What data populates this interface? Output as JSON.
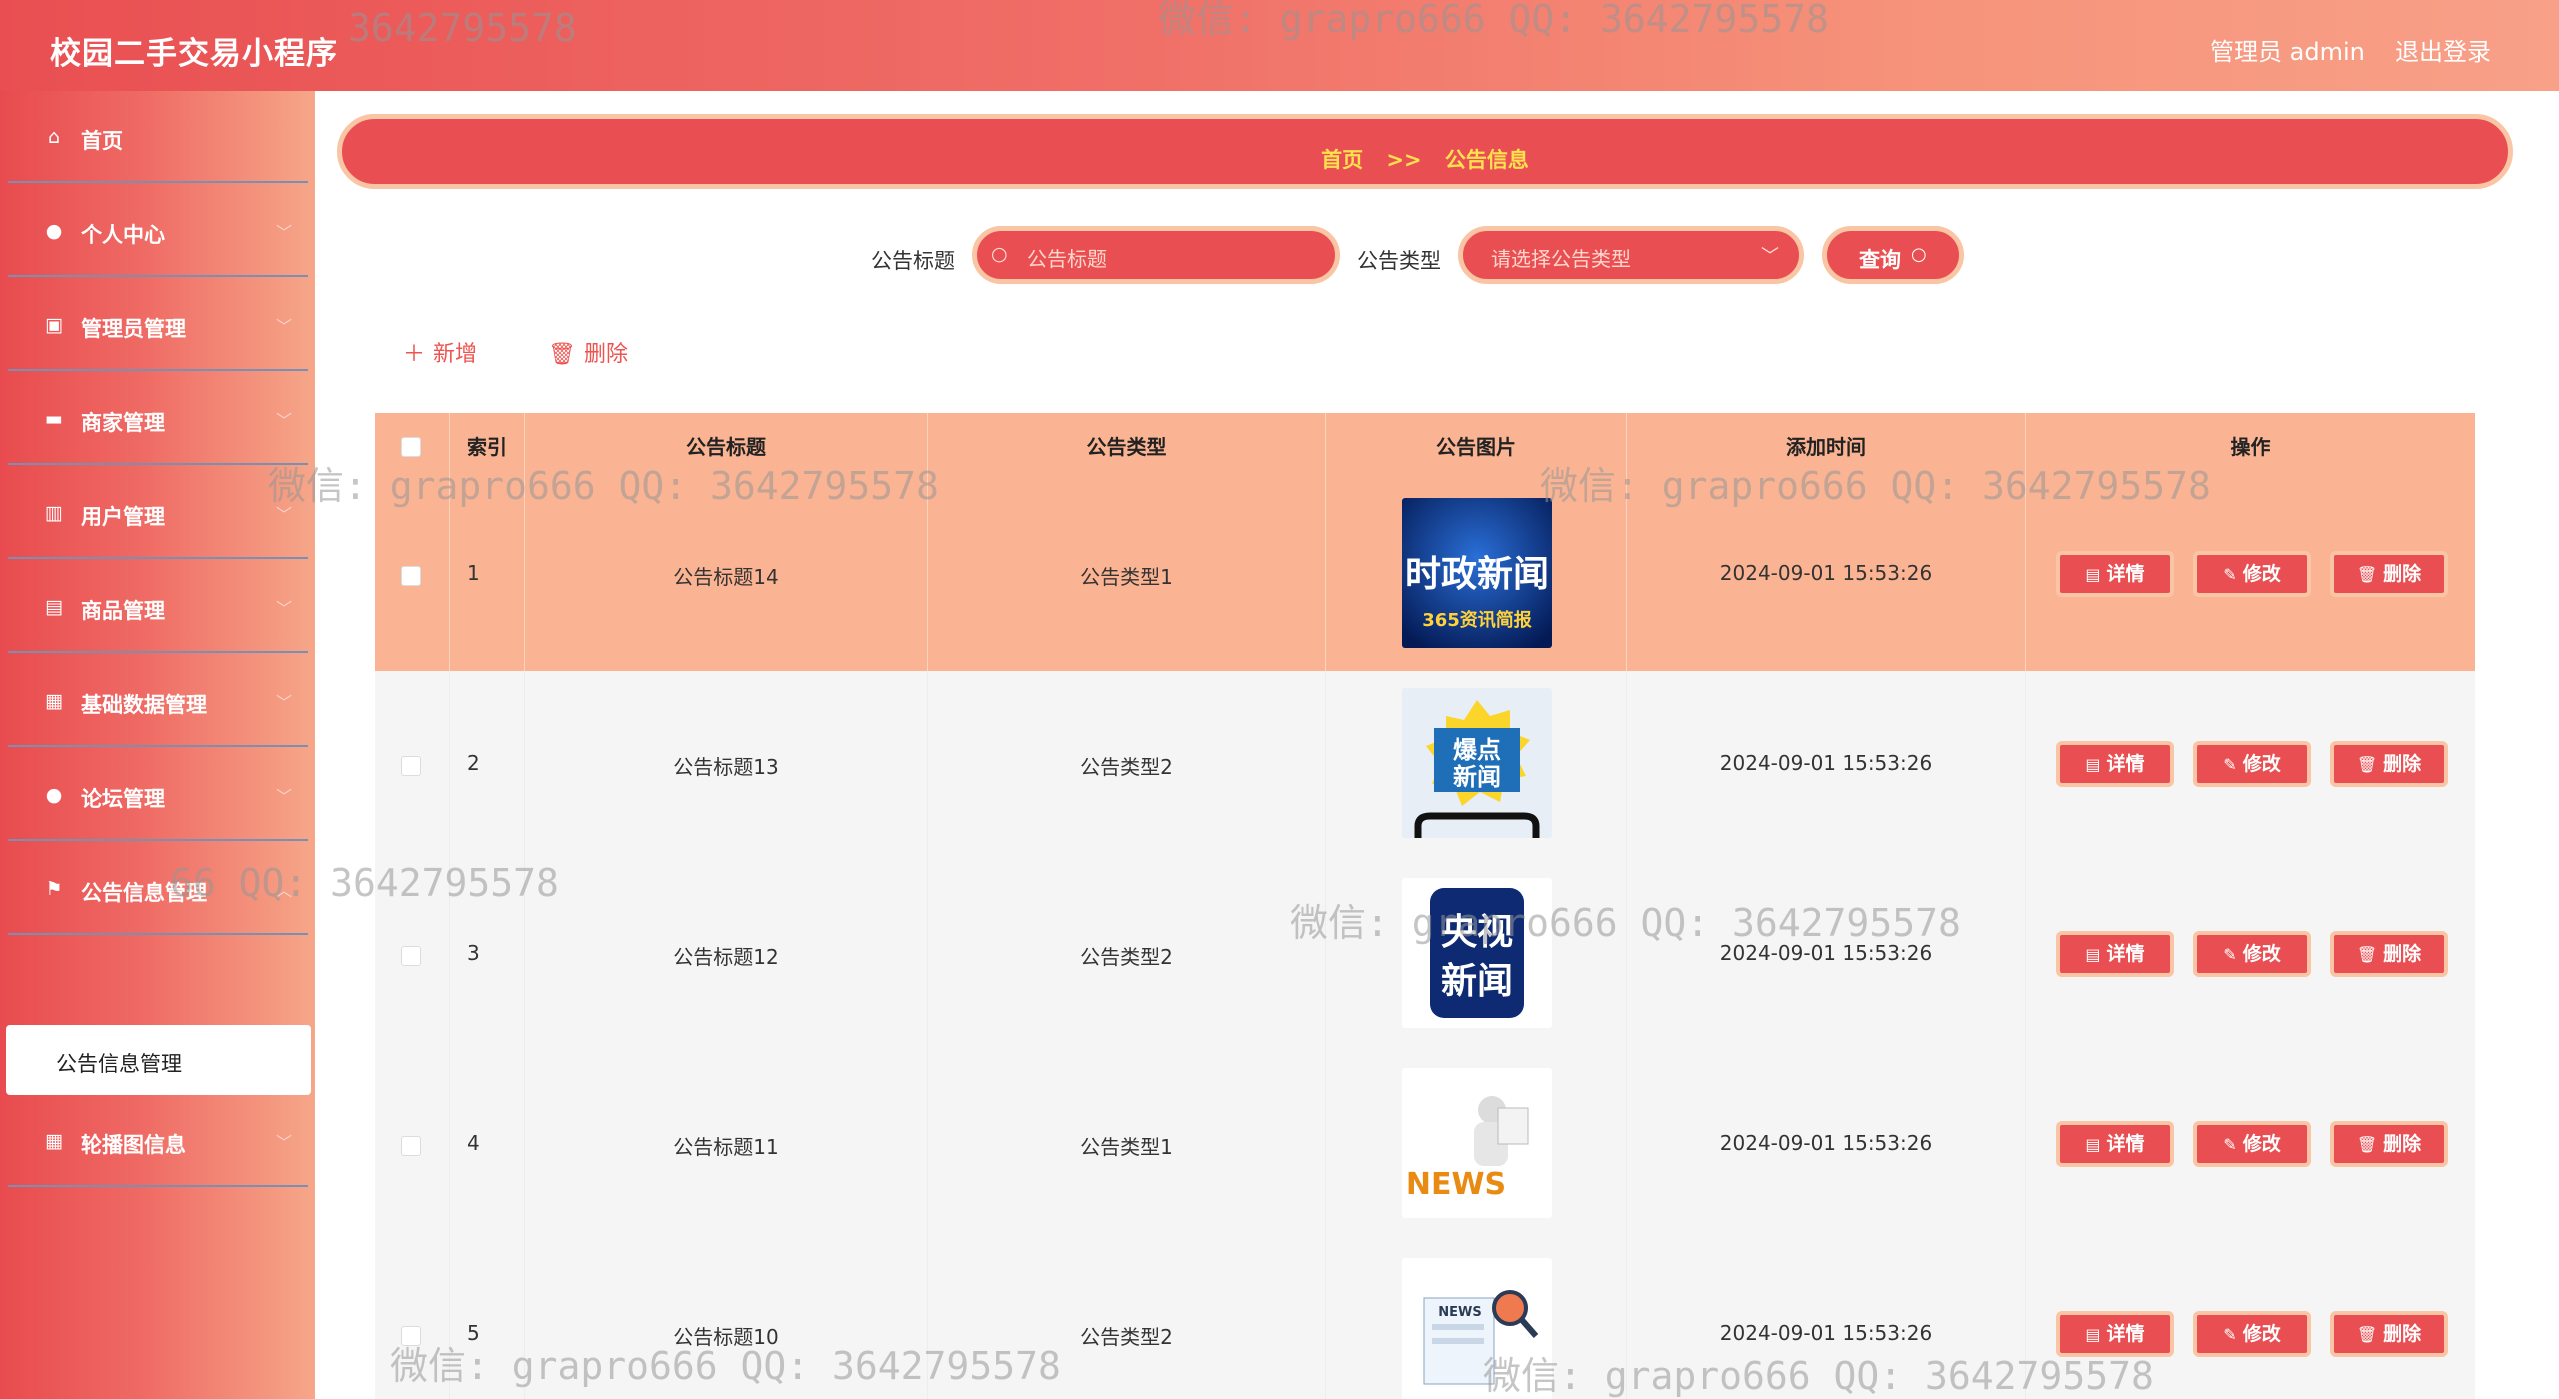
{
  "header": {
    "app_title": "校园二手交易小程序",
    "user": "管理员 admin",
    "logout": "退出登录"
  },
  "sidebar": {
    "items": [
      {
        "label": "首页",
        "icon": "home-icon",
        "glyph": "⌂"
      },
      {
        "label": "个人中心",
        "icon": "user-icon",
        "glyph": "👤"
      },
      {
        "label": "管理员管理",
        "icon": "clipboard-icon",
        "glyph": "▣"
      },
      {
        "label": "商家管理",
        "icon": "chat-icon",
        "glyph": "▬"
      },
      {
        "label": "用户管理",
        "icon": "chart-icon",
        "glyph": "▥"
      },
      {
        "label": "商品管理",
        "icon": "archive-icon",
        "glyph": "▤"
      },
      {
        "label": "基础数据管理",
        "icon": "grid-icon",
        "glyph": "▦"
      },
      {
        "label": "论坛管理",
        "icon": "pin-icon",
        "glyph": "●"
      },
      {
        "label": "公告信息管理",
        "icon": "flag-icon",
        "glyph": "⚑"
      },
      {
        "label": "轮播图信息",
        "icon": "grid-icon",
        "glyph": "▦"
      }
    ],
    "submenu_label": "公告信息管理"
  },
  "breadcrumb": {
    "home": "首页",
    "sep": ">>",
    "current": "公告信息"
  },
  "search": {
    "title_label": "公告标题",
    "title_placeholder": "公告标题",
    "type_label": "公告类型",
    "type_placeholder": "请选择公告类型",
    "query_label": "查询"
  },
  "actions": {
    "add": "新增",
    "delete": "删除"
  },
  "table": {
    "headers": [
      "索引",
      "公告标题",
      "公告类型",
      "公告图片",
      "添加时间",
      "操作"
    ],
    "rows": [
      {
        "index": "1",
        "title": "公告标题14",
        "type": "公告类型1",
        "time": "2024-09-01 15:53:26",
        "image": "时政新闻 365资讯简报"
      },
      {
        "index": "2",
        "title": "公告标题13",
        "type": "公告类型2",
        "time": "2024-09-01 15:53:26",
        "image": "爆点新闻"
      },
      {
        "index": "3",
        "title": "公告标题12",
        "type": "公告类型2",
        "time": "2024-09-01 15:53:26",
        "image": "央视新闻"
      },
      {
        "index": "4",
        "title": "公告标题11",
        "type": "公告类型1",
        "time": "2024-09-01 15:53:26",
        "image": "NEWS"
      },
      {
        "index": "5",
        "title": "公告标题10",
        "type": "公告类型2",
        "time": "2024-09-01 15:53:26",
        "image": "NEWS"
      }
    ],
    "op_labels": {
      "detail": "详情",
      "edit": "修改",
      "delete": "删除"
    }
  },
  "watermark": "微信: grapro666 QQ: 3642795578",
  "watermark_partial_1": "3642795578",
  "watermark_partial_2": "66 QQ: 3642795578",
  "colors": {
    "primary": "#e94f52",
    "border": "#f9c5a5",
    "header_row": "#fbb493",
    "crumb_text": "#ffe14f"
  }
}
